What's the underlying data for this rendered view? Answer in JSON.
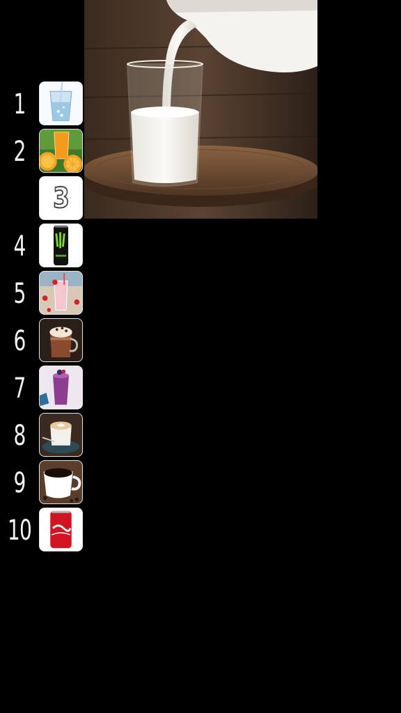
{
  "preview": {
    "subject": "milk-glass-being-poured-from-jug"
  },
  "ranking": [
    {
      "rank": "1",
      "drink": "water",
      "icon": "water-glass-icon"
    },
    {
      "rank": "2",
      "drink": "orange juice",
      "icon": "orange-juice-icon"
    },
    {
      "rank": "",
      "drink": "",
      "icon": "empty-slot-icon",
      "placeholder": "3"
    },
    {
      "rank": "4",
      "drink": "energy drink",
      "icon": "energy-drink-can-icon"
    },
    {
      "rank": "5",
      "drink": "strawberry milkshake",
      "icon": "strawberry-milkshake-icon"
    },
    {
      "rank": "6",
      "drink": "hot chocolate",
      "icon": "hot-chocolate-icon"
    },
    {
      "rank": "7",
      "drink": "berry smoothie",
      "icon": "berry-smoothie-icon"
    },
    {
      "rank": "8",
      "drink": "cappuccino",
      "icon": "cappuccino-icon"
    },
    {
      "rank": "9",
      "drink": "black coffee",
      "icon": "black-coffee-icon"
    },
    {
      "rank": "10",
      "drink": "cola",
      "icon": "cola-can-icon"
    }
  ]
}
